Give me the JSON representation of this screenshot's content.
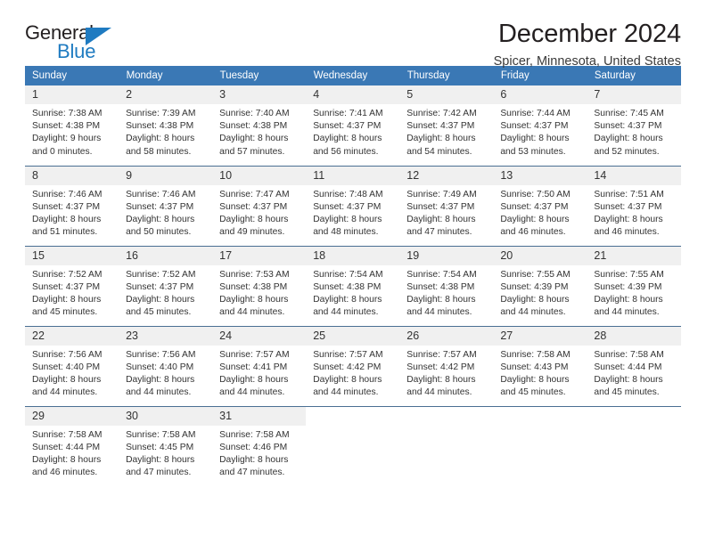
{
  "brand": {
    "word1": "General",
    "word2": "Blue",
    "triangle_color": "#1f7bc1",
    "text_color": "#231f20"
  },
  "header": {
    "title": "December 2024",
    "location": "Spicer, Minnesota, United States"
  },
  "theme": {
    "header_bg": "#3a78b5",
    "header_text": "#ffffff",
    "daynum_bg": "#f0f0f0",
    "grid_line": "#4a6f93",
    "body_text": "#333333"
  },
  "weekday_headers": [
    "Sunday",
    "Monday",
    "Tuesday",
    "Wednesday",
    "Thursday",
    "Friday",
    "Saturday"
  ],
  "labels": {
    "sunrise_prefix": "Sunrise:",
    "sunset_prefix": "Sunset:",
    "daylight_prefix": "Daylight:"
  },
  "weeks": [
    [
      {
        "day": "1",
        "l1": "Sunrise: 7:38 AM",
        "l2": "Sunset: 4:38 PM",
        "l3": "Daylight: 9 hours",
        "l4": "and 0 minutes."
      },
      {
        "day": "2",
        "l1": "Sunrise: 7:39 AM",
        "l2": "Sunset: 4:38 PM",
        "l3": "Daylight: 8 hours",
        "l4": "and 58 minutes."
      },
      {
        "day": "3",
        "l1": "Sunrise: 7:40 AM",
        "l2": "Sunset: 4:38 PM",
        "l3": "Daylight: 8 hours",
        "l4": "and 57 minutes."
      },
      {
        "day": "4",
        "l1": "Sunrise: 7:41 AM",
        "l2": "Sunset: 4:37 PM",
        "l3": "Daylight: 8 hours",
        "l4": "and 56 minutes."
      },
      {
        "day": "5",
        "l1": "Sunrise: 7:42 AM",
        "l2": "Sunset: 4:37 PM",
        "l3": "Daylight: 8 hours",
        "l4": "and 54 minutes."
      },
      {
        "day": "6",
        "l1": "Sunrise: 7:44 AM",
        "l2": "Sunset: 4:37 PM",
        "l3": "Daylight: 8 hours",
        "l4": "and 53 minutes."
      },
      {
        "day": "7",
        "l1": "Sunrise: 7:45 AM",
        "l2": "Sunset: 4:37 PM",
        "l3": "Daylight: 8 hours",
        "l4": "and 52 minutes."
      }
    ],
    [
      {
        "day": "8",
        "l1": "Sunrise: 7:46 AM",
        "l2": "Sunset: 4:37 PM",
        "l3": "Daylight: 8 hours",
        "l4": "and 51 minutes."
      },
      {
        "day": "9",
        "l1": "Sunrise: 7:46 AM",
        "l2": "Sunset: 4:37 PM",
        "l3": "Daylight: 8 hours",
        "l4": "and 50 minutes."
      },
      {
        "day": "10",
        "l1": "Sunrise: 7:47 AM",
        "l2": "Sunset: 4:37 PM",
        "l3": "Daylight: 8 hours",
        "l4": "and 49 minutes."
      },
      {
        "day": "11",
        "l1": "Sunrise: 7:48 AM",
        "l2": "Sunset: 4:37 PM",
        "l3": "Daylight: 8 hours",
        "l4": "and 48 minutes."
      },
      {
        "day": "12",
        "l1": "Sunrise: 7:49 AM",
        "l2": "Sunset: 4:37 PM",
        "l3": "Daylight: 8 hours",
        "l4": "and 47 minutes."
      },
      {
        "day": "13",
        "l1": "Sunrise: 7:50 AM",
        "l2": "Sunset: 4:37 PM",
        "l3": "Daylight: 8 hours",
        "l4": "and 46 minutes."
      },
      {
        "day": "14",
        "l1": "Sunrise: 7:51 AM",
        "l2": "Sunset: 4:37 PM",
        "l3": "Daylight: 8 hours",
        "l4": "and 46 minutes."
      }
    ],
    [
      {
        "day": "15",
        "l1": "Sunrise: 7:52 AM",
        "l2": "Sunset: 4:37 PM",
        "l3": "Daylight: 8 hours",
        "l4": "and 45 minutes."
      },
      {
        "day": "16",
        "l1": "Sunrise: 7:52 AM",
        "l2": "Sunset: 4:37 PM",
        "l3": "Daylight: 8 hours",
        "l4": "and 45 minutes."
      },
      {
        "day": "17",
        "l1": "Sunrise: 7:53 AM",
        "l2": "Sunset: 4:38 PM",
        "l3": "Daylight: 8 hours",
        "l4": "and 44 minutes."
      },
      {
        "day": "18",
        "l1": "Sunrise: 7:54 AM",
        "l2": "Sunset: 4:38 PM",
        "l3": "Daylight: 8 hours",
        "l4": "and 44 minutes."
      },
      {
        "day": "19",
        "l1": "Sunrise: 7:54 AM",
        "l2": "Sunset: 4:38 PM",
        "l3": "Daylight: 8 hours",
        "l4": "and 44 minutes."
      },
      {
        "day": "20",
        "l1": "Sunrise: 7:55 AM",
        "l2": "Sunset: 4:39 PM",
        "l3": "Daylight: 8 hours",
        "l4": "and 44 minutes."
      },
      {
        "day": "21",
        "l1": "Sunrise: 7:55 AM",
        "l2": "Sunset: 4:39 PM",
        "l3": "Daylight: 8 hours",
        "l4": "and 44 minutes."
      }
    ],
    [
      {
        "day": "22",
        "l1": "Sunrise: 7:56 AM",
        "l2": "Sunset: 4:40 PM",
        "l3": "Daylight: 8 hours",
        "l4": "and 44 minutes."
      },
      {
        "day": "23",
        "l1": "Sunrise: 7:56 AM",
        "l2": "Sunset: 4:40 PM",
        "l3": "Daylight: 8 hours",
        "l4": "and 44 minutes."
      },
      {
        "day": "24",
        "l1": "Sunrise: 7:57 AM",
        "l2": "Sunset: 4:41 PM",
        "l3": "Daylight: 8 hours",
        "l4": "and 44 minutes."
      },
      {
        "day": "25",
        "l1": "Sunrise: 7:57 AM",
        "l2": "Sunset: 4:42 PM",
        "l3": "Daylight: 8 hours",
        "l4": "and 44 minutes."
      },
      {
        "day": "26",
        "l1": "Sunrise: 7:57 AM",
        "l2": "Sunset: 4:42 PM",
        "l3": "Daylight: 8 hours",
        "l4": "and 44 minutes."
      },
      {
        "day": "27",
        "l1": "Sunrise: 7:58 AM",
        "l2": "Sunset: 4:43 PM",
        "l3": "Daylight: 8 hours",
        "l4": "and 45 minutes."
      },
      {
        "day": "28",
        "l1": "Sunrise: 7:58 AM",
        "l2": "Sunset: 4:44 PM",
        "l3": "Daylight: 8 hours",
        "l4": "and 45 minutes."
      }
    ],
    [
      {
        "day": "29",
        "l1": "Sunrise: 7:58 AM",
        "l2": "Sunset: 4:44 PM",
        "l3": "Daylight: 8 hours",
        "l4": "and 46 minutes."
      },
      {
        "day": "30",
        "l1": "Sunrise: 7:58 AM",
        "l2": "Sunset: 4:45 PM",
        "l3": "Daylight: 8 hours",
        "l4": "and 47 minutes."
      },
      {
        "day": "31",
        "l1": "Sunrise: 7:58 AM",
        "l2": "Sunset: 4:46 PM",
        "l3": "Daylight: 8 hours",
        "l4": "and 47 minutes."
      },
      {
        "day": "",
        "l1": "",
        "l2": "",
        "l3": "",
        "l4": ""
      },
      {
        "day": "",
        "l1": "",
        "l2": "",
        "l3": "",
        "l4": ""
      },
      {
        "day": "",
        "l1": "",
        "l2": "",
        "l3": "",
        "l4": ""
      },
      {
        "day": "",
        "l1": "",
        "l2": "",
        "l3": "",
        "l4": ""
      }
    ]
  ]
}
